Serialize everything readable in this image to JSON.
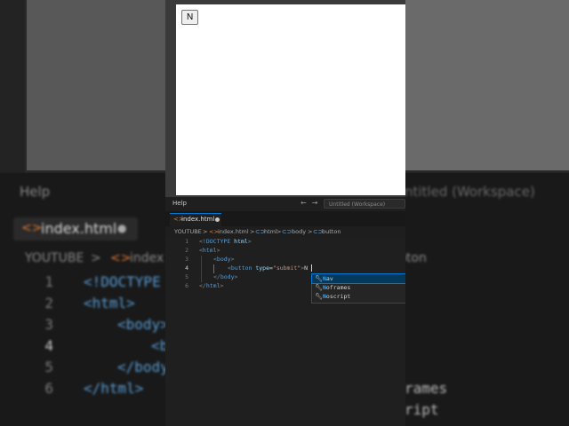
{
  "background": {
    "help": "Help",
    "tab_label": "index.html",
    "breadcrumb_root": "YOUTUBE",
    "breadcrumb_file": "index",
    "breadcrumb_right": "bton",
    "workspace": "ntitled (Workspace)",
    "line_numbers": [
      "1",
      "2",
      "3",
      "4",
      "5",
      "6"
    ],
    "code_lines": [
      "<!DOCTYPE",
      "<html>",
      "<body>",
      "<b",
      "</body",
      "</html>"
    ],
    "suggestion_fragments": [
      "rames",
      "ript"
    ]
  },
  "preview": {
    "button_label": "N"
  },
  "menubar": {
    "help": "Help",
    "back_arrow": "←",
    "forward_arrow": "→",
    "command_center": "Untitled (Workspace)"
  },
  "tab": {
    "label": "index.html"
  },
  "breadcrumb": {
    "root": "YOUTUBE",
    "sep": ">",
    "file": "index.html",
    "html": "html",
    "body": "body",
    "button": "button"
  },
  "editor": {
    "line_numbers": [
      "1",
      "2",
      "3",
      "4",
      "5",
      "6"
    ],
    "active_line": 4
  },
  "suggestions": {
    "items": [
      {
        "match": "N",
        "rest": "av"
      },
      {
        "match": "N",
        "rest": "oframes"
      },
      {
        "match": "N",
        "rest": "oscript"
      }
    ],
    "selected_index": 0
  },
  "colors": {
    "accent": "#0078d4",
    "tag": "#569cd6",
    "attr": "#9cdcfe",
    "string": "#ce9178"
  }
}
